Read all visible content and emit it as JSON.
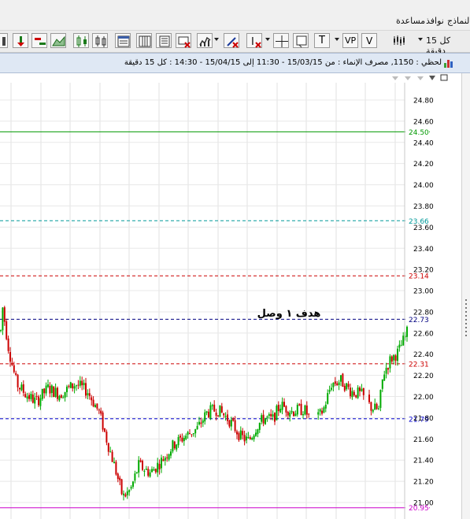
{
  "menu": {
    "items": [
      "مساعدة",
      "نوافذ",
      "النماذج"
    ]
  },
  "toolbar": {
    "timeframe_label": "كل 15 دقيقة",
    "text_tool_label": "T",
    "vp_tool_label": "VP",
    "v_tool_label": "V"
  },
  "chart_title": "لحظي : 1150, مصرف الإنماء : من 15/03/15 - 11:30 إلى 15/04/15 - 14:30 : كل 15 دقيقة",
  "annotation_text": "هدف ١ وصل",
  "chart_data": {
    "type": "candlestick",
    "ylim": [
      20.92,
      24.93
    ],
    "y_ticks": [
      "24.80",
      "24.60",
      "24.40",
      "24.20",
      "24.00",
      "23.80",
      "23.60",
      "23.40",
      "23.20",
      "23.00",
      "22.80",
      "22.60",
      "22.40",
      "22.20",
      "22.00",
      "21.80",
      "21.60",
      "21.40",
      "21.20",
      "21.00"
    ],
    "horizontal_levels": [
      {
        "value": 24.5,
        "label": "24.50",
        "color": "#009900",
        "style": "solid"
      },
      {
        "value": 23.66,
        "label": "23.66",
        "color": "#009999",
        "style": "dashed"
      },
      {
        "value": 23.14,
        "label": "23.14",
        "color": "#cc0000",
        "style": "dashed"
      },
      {
        "value": 22.73,
        "label": "22.73",
        "color": "#000080",
        "style": "dashed"
      },
      {
        "value": 22.31,
        "label": "22.31",
        "color": "#cc0000",
        "style": "dashed"
      },
      {
        "value": 21.79,
        "label": "21.79",
        "color": "#0000cc",
        "style": "dashed"
      },
      {
        "value": 20.95,
        "label": "20.95",
        "color": "#cc00cc",
        "style": "solid"
      }
    ],
    "up_color": "#00aa00",
    "down_color": "#cc0000",
    "candles": []
  }
}
